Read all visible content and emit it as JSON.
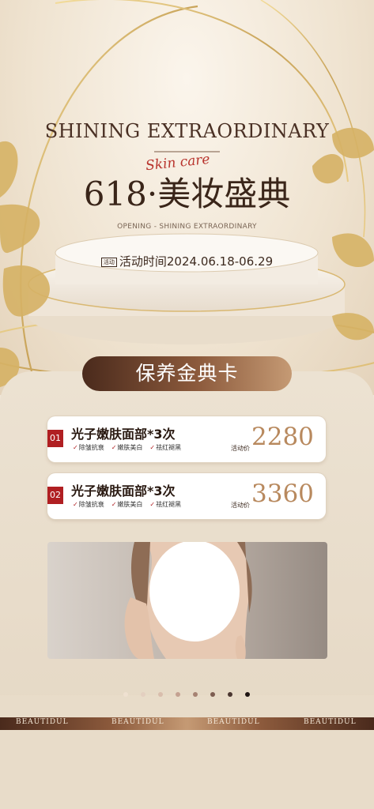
{
  "header": {
    "title_en": "SHINING EXTRAORDINARY",
    "script_text": "Skin care",
    "title_cn": "618·美妆盛典",
    "subtitle": "OPENING - SHINING EXTRAORDINARY",
    "date_tag": "活动",
    "date_text": "活动时间2024.06.18-06.29"
  },
  "section": {
    "title": "保养金典卡"
  },
  "cards": [
    {
      "num": "01",
      "title": "光子嫩肤面部*3次",
      "tags": [
        "除皱抗衰",
        "嫩肤美白",
        "祛红褪黑"
      ],
      "price_label": "活动价",
      "price": "2280"
    },
    {
      "num": "02",
      "title": "光子嫩肤面部*3次",
      "tags": [
        "除皱抗衰",
        "嫩肤美白",
        "祛红褪黑"
      ],
      "price_label": "活动价",
      "price": "3360"
    }
  ],
  "carousel": {
    "count": 8,
    "active": 7
  },
  "footer_strip": [
    "BEAUTIDUL",
    "BEAUTIDUL",
    "BEAUTIDUL",
    "BEAUTIDUL"
  ],
  "colors": {
    "accent_red": "#b01f22",
    "brown_dark": "#4a2a1c",
    "gold": "#c9a45a",
    "price_gold": "#b8895e"
  },
  "icons": [
    "gold-leaf-icon",
    "podium-icon",
    "face-placeholder-icon"
  ]
}
